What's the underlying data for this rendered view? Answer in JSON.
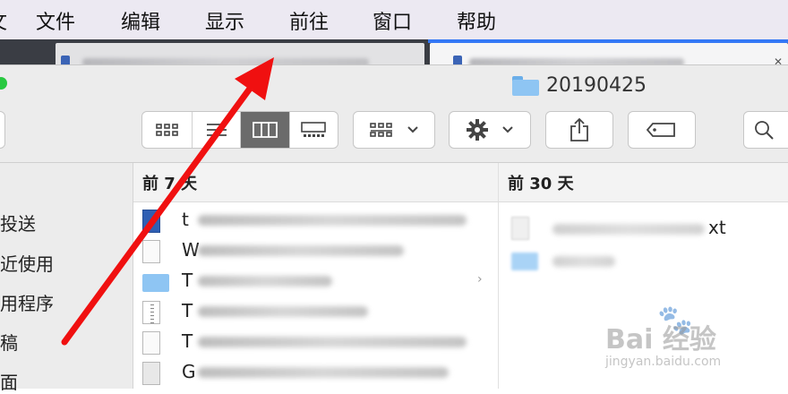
{
  "menubar": {
    "items": [
      "文件",
      "编辑",
      "显示",
      "前往",
      "窗口",
      "帮助"
    ],
    "partial_left": "文件"
  },
  "window": {
    "title": "20190425"
  },
  "toolbar": {
    "view_icons": [
      "icon-view-icon",
      "list-view-icon",
      "column-view-icon",
      "gallery-view-icon"
    ],
    "selected_view": "column-view-icon"
  },
  "sidebar": {
    "items": [
      "空投送",
      "最近使用",
      "应用程序",
      "文稿",
      "桌面"
    ]
  },
  "columns": {
    "col1_header": "前 7 天",
    "col2_header": "前 30 天",
    "col1_leads": [
      "t",
      "W",
      "T",
      "T",
      "T",
      "G"
    ],
    "col2_tail": "xt"
  },
  "watermark": {
    "brand": "Bai 经验",
    "url": "jingyan.baidu.com"
  },
  "colors": {
    "annotation_arrow": "#f01010",
    "selected_segment": "#6b6b6b",
    "tab_accent": "#3478f6"
  }
}
